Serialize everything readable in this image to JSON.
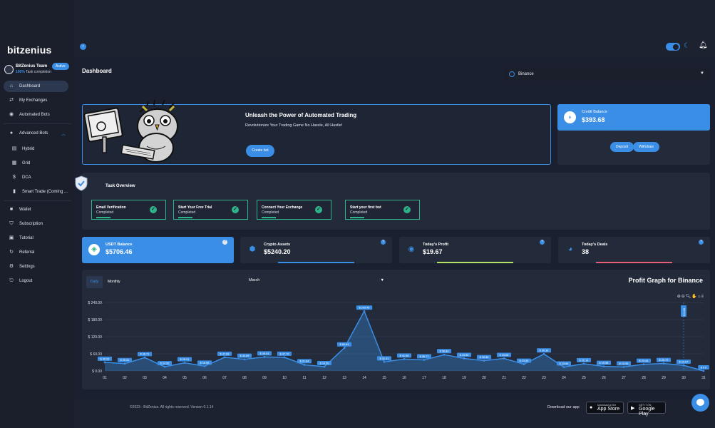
{
  "brand": "bitzenius",
  "team": {
    "name": "BitZenius Team",
    "progress_pct": "100%",
    "progress_label": "Task completion",
    "badge": "Active"
  },
  "sidebar": {
    "items": [
      {
        "label": "Dashboard",
        "icon": "home-icon"
      },
      {
        "label": "My Exchanges",
        "icon": "exchange-icon"
      },
      {
        "label": "Automated Bots",
        "icon": "bot-icon"
      },
      {
        "label": "Advanced Bots",
        "icon": "robot-icon"
      },
      {
        "label": "Hybrid",
        "icon": "hybrid-icon"
      },
      {
        "label": "Grid",
        "icon": "grid-icon"
      },
      {
        "label": "DCA",
        "icon": "dca-icon"
      },
      {
        "label": "Smart Trade (Coming ...",
        "icon": "smart-trade-icon"
      },
      {
        "label": "Wallet",
        "icon": "wallet-icon"
      },
      {
        "label": "Subscription",
        "icon": "shield-icon"
      },
      {
        "label": "Tutorial",
        "icon": "book-icon"
      },
      {
        "label": "Referral",
        "icon": "referral-icon"
      },
      {
        "label": "Settings",
        "icon": "gear-icon"
      },
      {
        "label": "Logout",
        "icon": "logout-icon"
      }
    ]
  },
  "header": {
    "title": "Dashboard",
    "exchange": "Binance"
  },
  "hero": {
    "title": "Unleash the Power of Automated Trading",
    "subtitle": "Revolutionize Your Trading Game No Hassle, All Hustle!",
    "button": "Create bot"
  },
  "credit": {
    "label": "Credit Balance",
    "amount": "$393.68",
    "deposit": "Deposit",
    "withdraw": "Withdraw"
  },
  "tasks": {
    "title": "Task Overview",
    "items": [
      {
        "name": "Email Verification",
        "status": "Completed"
      },
      {
        "name": "Start Your Free Trial",
        "status": "Completed"
      },
      {
        "name": "Connect Your Exchange",
        "status": "Completed"
      },
      {
        "name": "Start your first bot",
        "status": "Completed"
      }
    ]
  },
  "stats": [
    {
      "label": "USDT Balance",
      "amount": "$5706.46",
      "color": "#3a8ee6"
    },
    {
      "label": "Crypto Assets",
      "amount": "$5240.20",
      "color": "#3a8ee6"
    },
    {
      "label": "Today's Profit",
      "amount": "$19.67",
      "color": "#b5e36a"
    },
    {
      "label": "Today's Deals",
      "amount": "38",
      "color": "#e95b7a"
    }
  ],
  "chart_controls": {
    "daily": "Daily",
    "monthly": "Monthly",
    "month": "March",
    "title": "Profit Graph for Binance"
  },
  "chart_data": {
    "type": "area",
    "ylim": [
      0,
      240
    ],
    "yticks": [
      "$ 0.00",
      "$ 60.00",
      "$ 120.00",
      "$ 180.00",
      "$ 240.00"
    ],
    "categories": [
      "01",
      "02",
      "03",
      "04",
      "05",
      "06",
      "07",
      "08",
      "09",
      "10",
      "11",
      "12",
      "13",
      "14",
      "15",
      "16",
      "17",
      "18",
      "19",
      "20",
      "21",
      "22",
      "23",
      "24",
      "25",
      "26",
      "27",
      "28",
      "29",
      "30",
      "31"
    ],
    "values": [
      30.26,
      25.51,
      46.71,
      14.56,
      28.51,
      16.56,
      47.68,
      40.89,
      49.04,
      47.76,
      21.64,
      14.89,
      80.64,
      209.46,
      31.61,
      41.56,
      38.77,
      56.89,
      43.86,
      35.88,
      43.68,
      23.56,
      59.36,
      13.64,
      25.16,
      15.98,
      13.95,
      23.44,
      25.79,
      19.67,
      0.0
    ],
    "labels": [
      "$ 30.26",
      "$ 25.51",
      "$ 46.71",
      "$ 14.56",
      "$ 28.51",
      "$ 16.56",
      "$ 47.68",
      "$ 40.89",
      "$ 49.04",
      "$ 47.76",
      "$ 21.64",
      "$ 14.89",
      "$ 80.64",
      "$ 209.46",
      "$ 31.61",
      "$ 41.56",
      "$ 38.77",
      "$ 56.89",
      "$ 43.86",
      "$ 35.88",
      "$ 43.68",
      "$ 23.56",
      "$ 59.36",
      "$ 13.64",
      "$ 25.16",
      "$ 15.98",
      "$ 13.95",
      "$ 23.44",
      "$ 25.79",
      "$ 19.67",
      "$ 0.0"
    ],
    "marker_label": "$ 0.00",
    "marker_category": "30"
  },
  "footer": {
    "copyright": "©2023 - BitZenius. All rights reserved. Version 0.1.14",
    "download": "Download our app",
    "appstore_top": "Download on the",
    "appstore": "App Store",
    "googleplay_top": "GET IT ON",
    "googleplay": "Google Play"
  },
  "colors": {
    "accent": "#3a8ee6",
    "success": "#2fb38a",
    "bg": "#1d2230",
    "card": "#232a3a"
  }
}
